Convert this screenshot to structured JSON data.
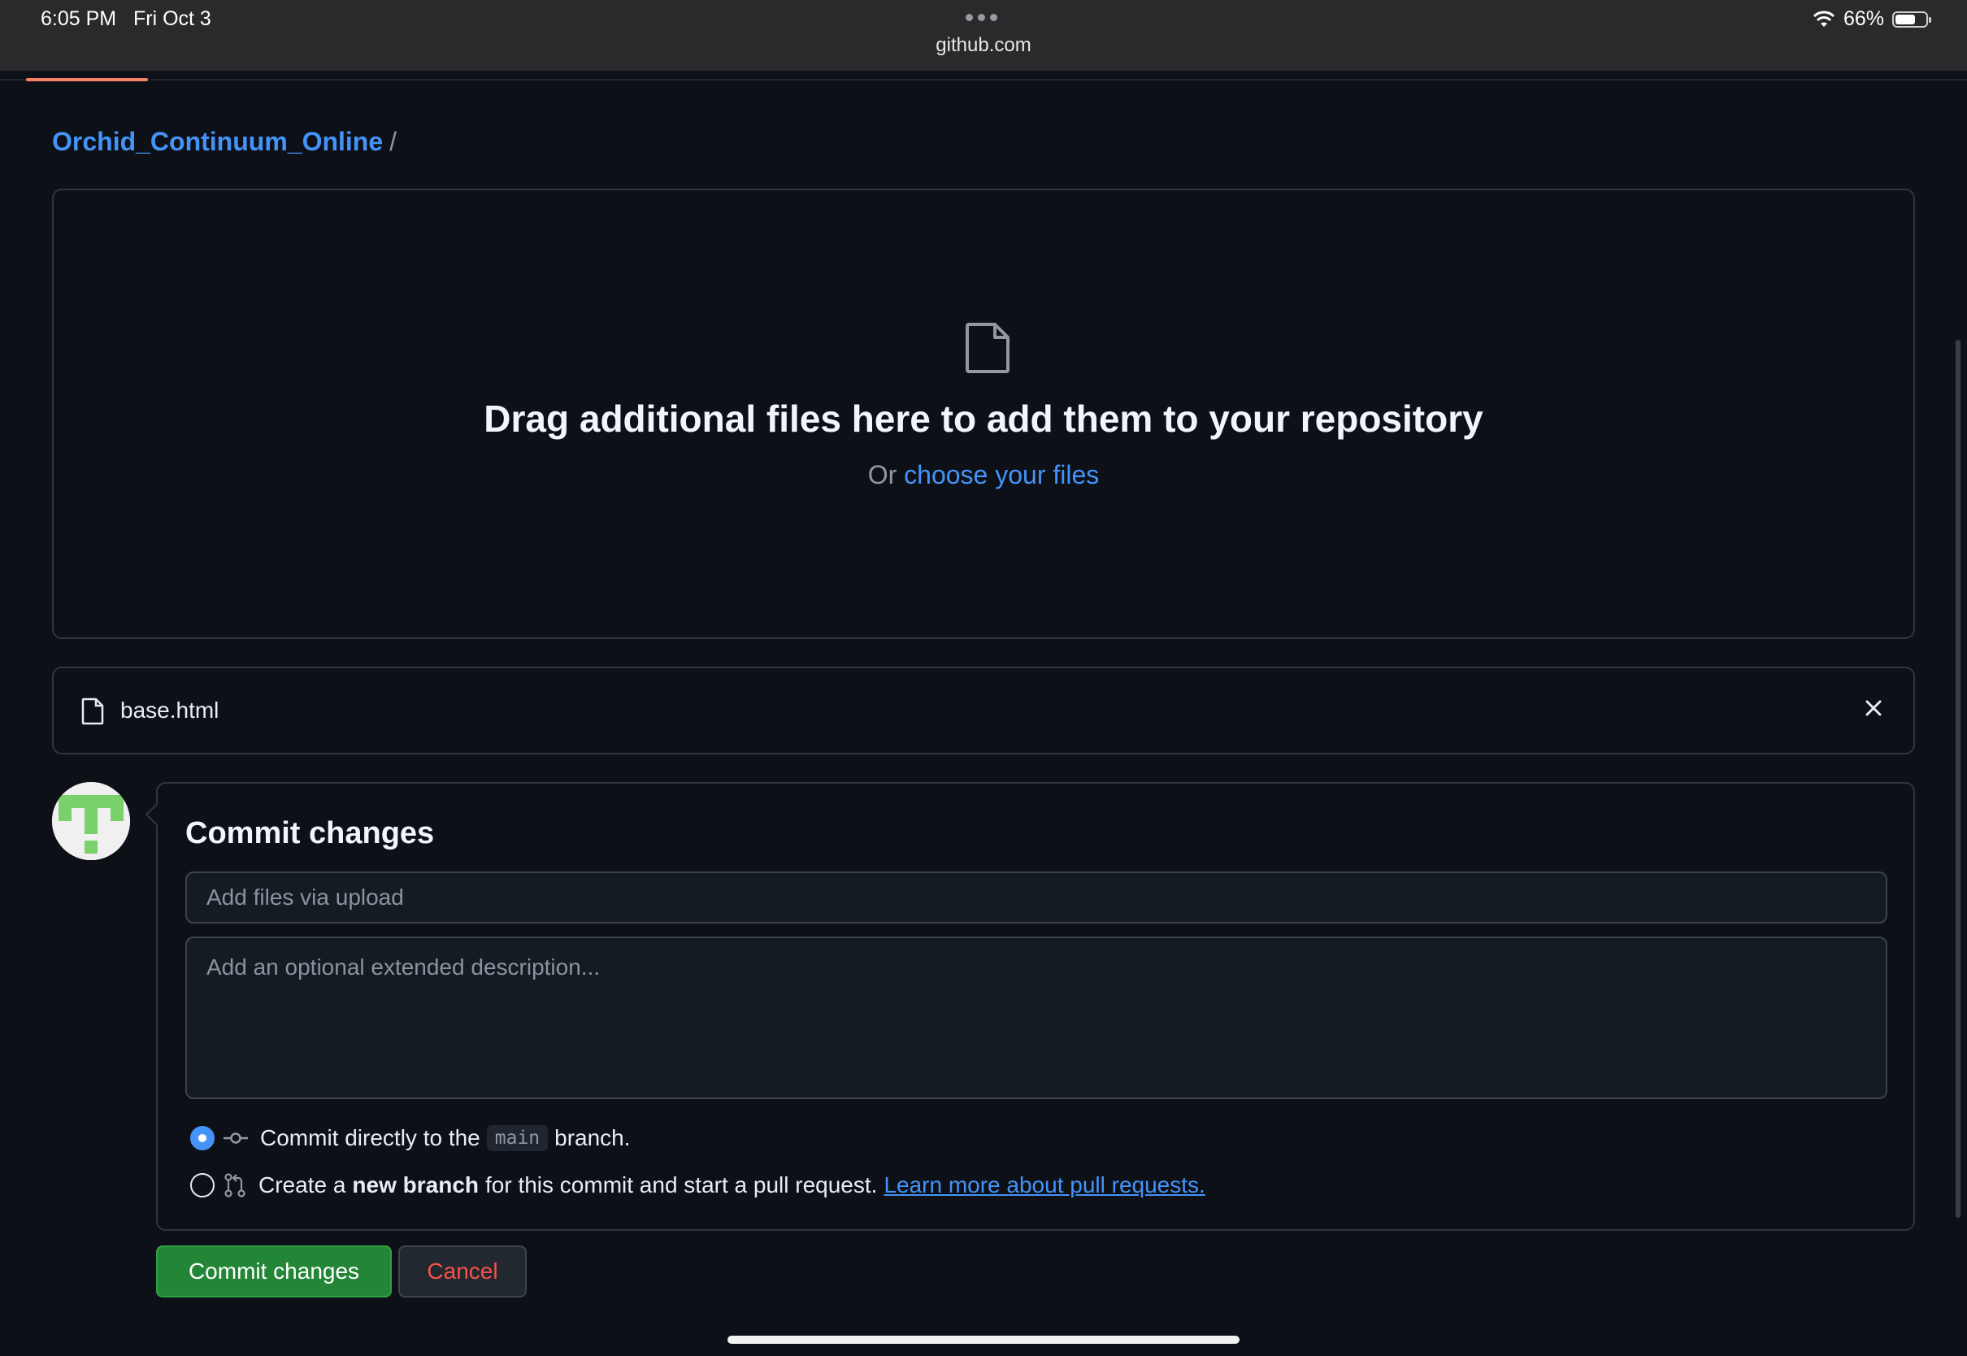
{
  "status_bar": {
    "time": "6:05 PM",
    "date": "Fri Oct 3",
    "url": "github.com",
    "battery_percent": "66%",
    "battery_level": 0.66,
    "wifi_icon": "wifi-icon",
    "menu_icon": "more-dots-icon"
  },
  "page_load_progress": 0.06,
  "breadcrumb": {
    "repo": "Orchid_Continuum_Online",
    "separator": "/"
  },
  "dropzone": {
    "icon": "file-icon",
    "title": "Drag additional files here to add them to your repository",
    "or_text": "Or",
    "choose_link": "choose your files"
  },
  "files": [
    {
      "name": "base.html",
      "icon": "file-icon",
      "remove_icon": "close-icon"
    }
  ],
  "commit": {
    "title": "Commit changes",
    "summary_placeholder": "Add files via upload",
    "description_placeholder": "Add an optional extended description...",
    "option_direct": {
      "prefix": "Commit directly to the",
      "branch": "main",
      "suffix": "branch.",
      "selected": true,
      "icon": "git-commit-icon"
    },
    "option_new_branch": {
      "prefix": "Create a",
      "bold": "new branch",
      "suffix": "for this commit and start a pull request.",
      "link": "Learn more about pull requests.",
      "selected": false,
      "icon": "git-pull-request-icon"
    }
  },
  "buttons": {
    "commit": "Commit changes",
    "cancel": "Cancel"
  },
  "colors": {
    "background": "#0d1117",
    "link": "#4493f8",
    "primary_button": "#238636",
    "danger_text": "#f85149",
    "border": "#30363d"
  }
}
